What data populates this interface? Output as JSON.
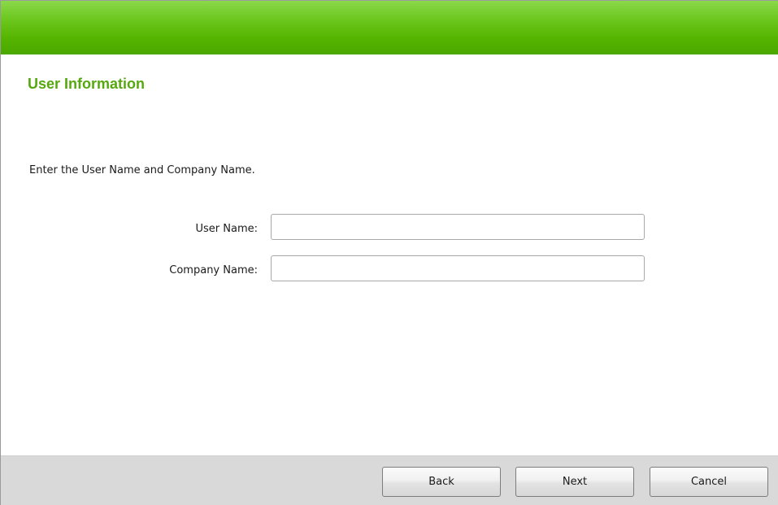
{
  "header": {
    "title": "User Information"
  },
  "main": {
    "instruction": "Enter the User Name and Company Name.",
    "fields": [
      {
        "label": "User Name:",
        "value": "",
        "placeholder": ""
      },
      {
        "label": "Company Name:",
        "value": "",
        "placeholder": ""
      }
    ]
  },
  "footer": {
    "back_label": "Back",
    "next_label": "Next",
    "cancel_label": "Cancel"
  },
  "colors": {
    "banner_green": "#55b400",
    "title_green": "#56a80f",
    "footer_gray": "#d9d9d9"
  }
}
